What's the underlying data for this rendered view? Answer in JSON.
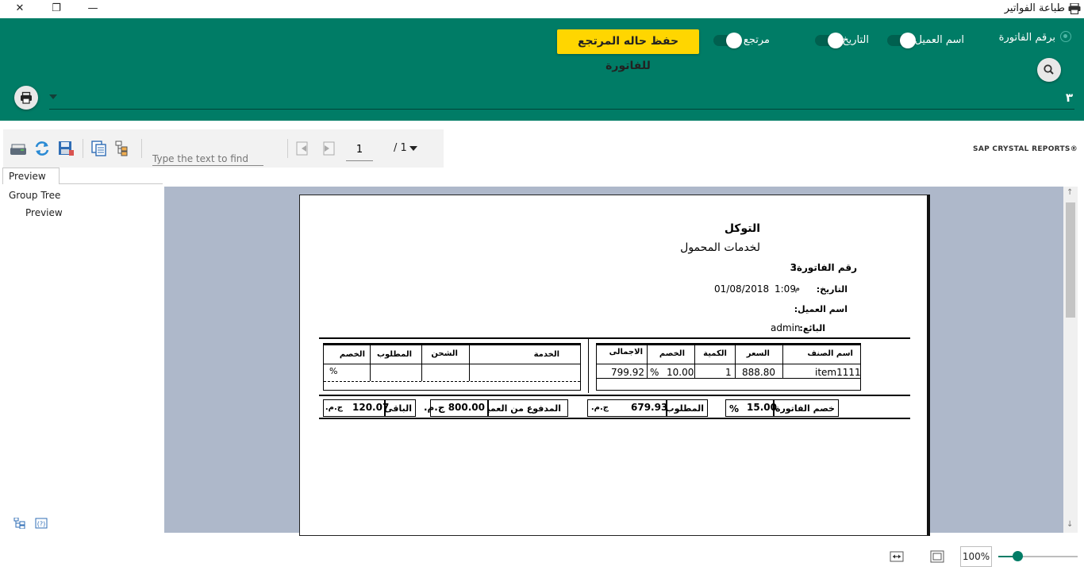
{
  "window": {
    "title": "طباعة الفواتير",
    "controls": [
      "close",
      "maximize",
      "minimize"
    ]
  },
  "header_panel": {
    "accent_color": "#007c66",
    "radio_invoice_number": "برقم الفاتورة",
    "toggle_customer_name": "اسم العميل",
    "toggle_date": "التاريخ",
    "toggle_return": "مرتجع",
    "save_return_button": "حفظ حاله المرتجع للفاتورة",
    "save_button_color": "#ffd600",
    "invoice_input_value": "٣"
  },
  "viewer_toolbar": {
    "find_placeholder": "Type the text to find",
    "current_page": "1",
    "page_total": "/ 1",
    "brand": "SAP CRYSTAL REPORTS®"
  },
  "left_pane": {
    "tab_label": "Preview",
    "group_tree_label": "Group Tree",
    "tree_item": "Preview"
  },
  "report": {
    "company_name": "التوكل",
    "company_subtitle": "لخدمات المحمول",
    "invoice_number_label": "رقم الفاتورة:",
    "invoice_number_value": "3",
    "date_label": "التاريخ:",
    "date_value": "01/08/2018",
    "time_value": "1:09",
    "time_suffix": "م",
    "customer_label": "اسم العميل:",
    "seller_label": "البائع:",
    "seller_value": "admin",
    "items_table": {
      "headers": [
        "اسم الصنف",
        "السعر",
        "الكمية",
        "الخصم",
        "الاجمالى"
      ],
      "row": {
        "item": "item1111",
        "price": "888.80",
        "qty": "1",
        "discount": "10.00",
        "discount_pct": "%",
        "total": "799.92"
      }
    },
    "services_table": {
      "headers": [
        "الخدمة",
        "الشحن",
        "المطلوب",
        "الخصم"
      ],
      "row": {
        "discount_pct": "%"
      }
    },
    "totals": {
      "invoice_discount_label": "خصم الفاتورة:",
      "invoice_discount_value": "15.00",
      "invoice_discount_pct": "%",
      "required_label": "المطلوب:",
      "required_value": "679.93",
      "required_currency": "ج.م.",
      "paid_label": "المدفوع من العميل:",
      "paid_value": "800.00 ج.م.",
      "remaining_label": "الباقى:",
      "remaining_value": "120.07",
      "remaining_currency": "ج.م."
    }
  },
  "status_bar": {
    "zoom": "100%",
    "zoom_level_fraction": 0.24
  }
}
